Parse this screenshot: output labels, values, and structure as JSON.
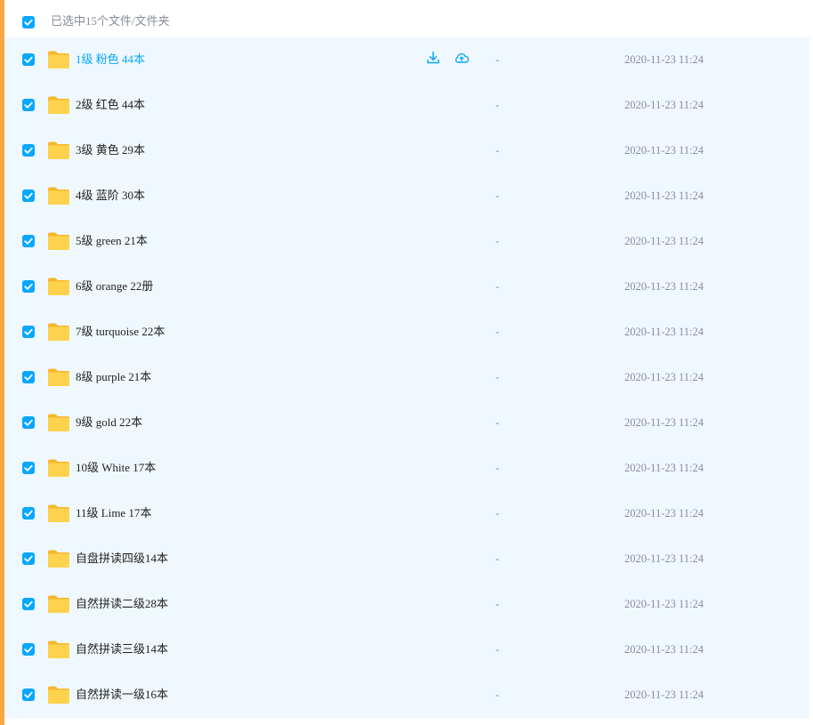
{
  "header": {
    "selection_label": "已选中15个文件/文件夹"
  },
  "accent_color": "#f7a842",
  "check_color": "#06a7ff",
  "hover_text_color": "#06a7ff",
  "row_actions": {
    "download_icon": "download-icon",
    "cloud_icon": "cloud-upload-icon"
  },
  "rows": [
    {
      "name": "1级 粉色 44本",
      "size": "-",
      "date": "2020-11-23 11:24",
      "hover": true
    },
    {
      "name": "2级 红色 44本",
      "size": "-",
      "date": "2020-11-23 11:24"
    },
    {
      "name": "3级 黄色 29本",
      "size": "-",
      "date": "2020-11-23 11:24"
    },
    {
      "name": "4级 蓝阶 30本",
      "size": "-",
      "date": "2020-11-23 11:24"
    },
    {
      "name": "5级 green 21本",
      "size": "-",
      "date": "2020-11-23 11:24"
    },
    {
      "name": "6级 orange 22册",
      "size": "-",
      "date": "2020-11-23 11:24"
    },
    {
      "name": "7级 turquoise 22本",
      "size": "-",
      "date": "2020-11-23 11:24"
    },
    {
      "name": "8级 purple 21本",
      "size": "-",
      "date": "2020-11-23 11:24"
    },
    {
      "name": "9级 gold 22本",
      "size": "-",
      "date": "2020-11-23 11:24"
    },
    {
      "name": "10级 White 17本",
      "size": "-",
      "date": "2020-11-23 11:24"
    },
    {
      "name": "11级 Lime 17本",
      "size": "-",
      "date": "2020-11-23 11:24"
    },
    {
      "name": "自盘拼读四级14本",
      "size": "-",
      "date": "2020-11-23 11:24"
    },
    {
      "name": "自然拼读二级28本",
      "size": "-",
      "date": "2020-11-23 11:24"
    },
    {
      "name": "自然拼读三级14本",
      "size": "-",
      "date": "2020-11-23 11:24"
    },
    {
      "name": "自然拼读一级16本",
      "size": "-",
      "date": "2020-11-23 11:24"
    }
  ]
}
